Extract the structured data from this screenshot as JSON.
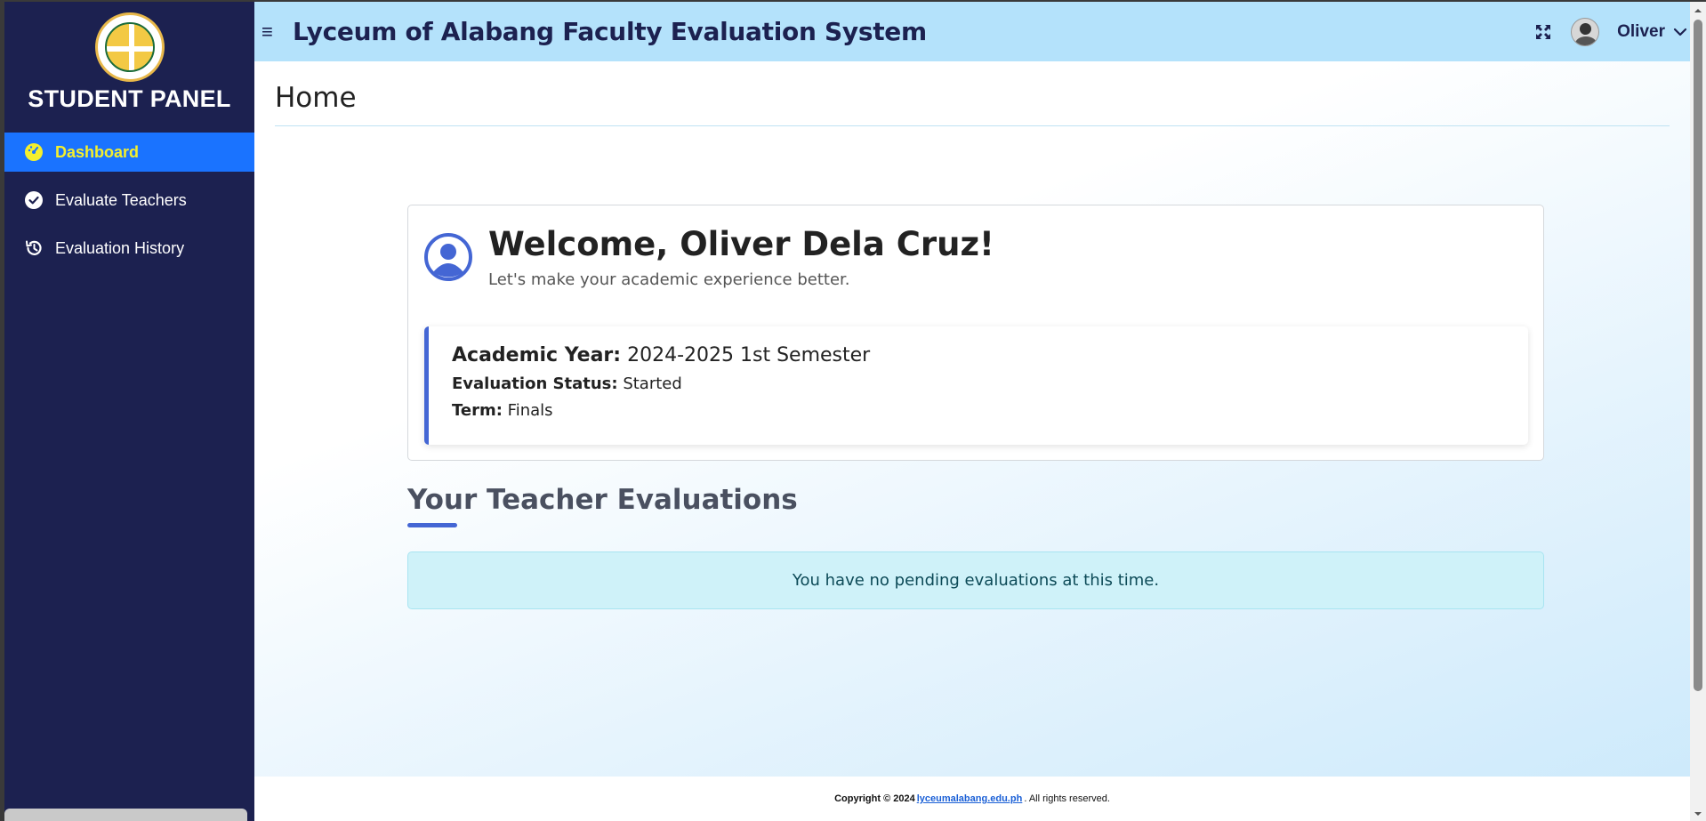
{
  "sidebar": {
    "panel_title": "STUDENT PANEL",
    "logo_alt": "Lyceum of Alabang seal",
    "items": [
      {
        "label": "Dashboard",
        "icon": "gauge-icon",
        "active": true
      },
      {
        "label": "Evaluate Teachers",
        "icon": "check-circle-icon",
        "active": false
      },
      {
        "label": "Evaluation History",
        "icon": "history-icon",
        "active": false
      }
    ]
  },
  "header": {
    "app_title": "Lyceum of Alabang Faculty Evaluation System",
    "username": "Oliver"
  },
  "page": {
    "title": "Home"
  },
  "welcome": {
    "title": "Welcome, Oliver Dela Cruz!",
    "subtitle": "Let's make your academic experience better.",
    "academic_year_label": "Academic Year:",
    "academic_year_value": "2024-2025 1st Semester",
    "status_label": "Evaluation Status:",
    "status_value": "Started",
    "term_label": "Term:",
    "term_value": "Finals"
  },
  "evaluations": {
    "section_title": "Your Teacher Evaluations",
    "empty_message": "You have no pending evaluations at this time."
  },
  "footer": {
    "copyright": "Copyright © 2024",
    "link_text": "lyceumalabang.edu.ph",
    "rights": ". All rights reserved."
  },
  "colors": {
    "sidebar_bg": "#1c2150",
    "active_item_bg": "#1a73ff",
    "active_item_text": "#f4ef2d",
    "topbar_bg": "#b4e2fb",
    "accent": "#4466d4",
    "info_bg": "#cff2f9"
  }
}
